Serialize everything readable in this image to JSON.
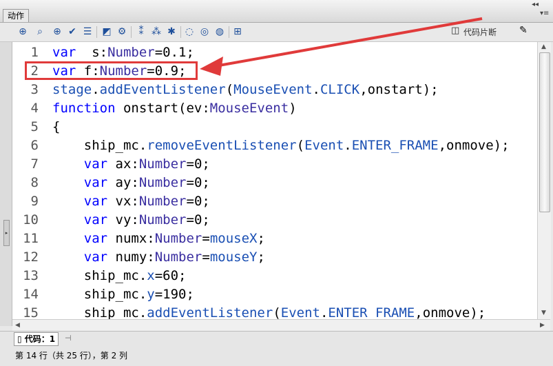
{
  "panel": {
    "tab_label": "动作",
    "collapse_glyph": "◂◂",
    "menu_glyph": "▾≡"
  },
  "toolbar": {
    "icons": [
      "add-statement-icon",
      "find-icon",
      "insert-target-path-icon",
      "check-syntax-icon",
      "auto-format-icon",
      "code-hint-icon",
      "debug-options-icon",
      "collapse-between-braces-icon",
      "collapse-selection-icon",
      "expand-all-icon",
      "apply-block-comment-icon",
      "apply-line-comment-icon",
      "remove-comment-icon",
      "show-hide-toolbox-icon"
    ],
    "snippets_label": "代码片断",
    "wand_icon": "magic-wand-icon"
  },
  "code_lines": [
    {
      "n": "1",
      "tokens": [
        [
          "kw",
          "var"
        ],
        [
          "",
          "  s:"
        ],
        [
          "ty",
          "Number"
        ],
        [
          "",
          "=0.1;"
        ]
      ]
    },
    {
      "n": "2",
      "tokens": [
        [
          "kw",
          "var"
        ],
        [
          "",
          " f:"
        ],
        [
          "ty",
          "Number"
        ],
        [
          "",
          "=0.9;"
        ]
      ]
    },
    {
      "n": "3",
      "tokens": [
        [
          "pm",
          "stage"
        ],
        [
          "",
          "."
        ],
        [
          "pm",
          "addEventListener"
        ],
        [
          "",
          "("
        ],
        [
          "pm",
          "MouseEvent"
        ],
        [
          "",
          "."
        ],
        [
          "pm",
          "CLICK"
        ],
        [
          "",
          ",onstart);"
        ]
      ]
    },
    {
      "n": "4",
      "tokens": [
        [
          "kw",
          "function"
        ],
        [
          "",
          " onstart(ev:"
        ],
        [
          "ty",
          "MouseEvent"
        ],
        [
          "",
          ")"
        ]
      ]
    },
    {
      "n": "5",
      "tokens": [
        [
          "",
          "{"
        ]
      ]
    },
    {
      "n": "6",
      "tokens": [
        [
          "",
          "    ship_mc."
        ],
        [
          "pm",
          "removeEventListener"
        ],
        [
          "",
          "("
        ],
        [
          "pm",
          "Event"
        ],
        [
          "",
          "."
        ],
        [
          "pm",
          "ENTER_FRAME"
        ],
        [
          "",
          ",onmove);"
        ]
      ]
    },
    {
      "n": "7",
      "tokens": [
        [
          "",
          "    "
        ],
        [
          "kw",
          "var"
        ],
        [
          "",
          " ax:"
        ],
        [
          "ty",
          "Number"
        ],
        [
          "",
          "=0;"
        ]
      ]
    },
    {
      "n": "8",
      "tokens": [
        [
          "",
          "    "
        ],
        [
          "kw",
          "var"
        ],
        [
          "",
          " ay:"
        ],
        [
          "ty",
          "Number"
        ],
        [
          "",
          "=0;"
        ]
      ]
    },
    {
      "n": "9",
      "tokens": [
        [
          "",
          "    "
        ],
        [
          "kw",
          "var"
        ],
        [
          "",
          " vx:"
        ],
        [
          "ty",
          "Number"
        ],
        [
          "",
          "=0;"
        ]
      ]
    },
    {
      "n": "10",
      "tokens": [
        [
          "",
          "    "
        ],
        [
          "kw",
          "var"
        ],
        [
          "",
          " vy:"
        ],
        [
          "ty",
          "Number"
        ],
        [
          "",
          "=0;"
        ]
      ]
    },
    {
      "n": "11",
      "tokens": [
        [
          "",
          "    "
        ],
        [
          "kw",
          "var"
        ],
        [
          "",
          " numx:"
        ],
        [
          "ty",
          "Number"
        ],
        [
          "",
          "="
        ],
        [
          "pm",
          "mouseX"
        ],
        [
          "",
          ";"
        ]
      ]
    },
    {
      "n": "12",
      "tokens": [
        [
          "",
          "    "
        ],
        [
          "kw",
          "var"
        ],
        [
          "",
          " numy:"
        ],
        [
          "ty",
          "Number"
        ],
        [
          "",
          "="
        ],
        [
          "pm",
          "mouseY"
        ],
        [
          "",
          ";"
        ]
      ]
    },
    {
      "n": "13",
      "tokens": [
        [
          "",
          "    ship_mc."
        ],
        [
          "pm",
          "x"
        ],
        [
          "",
          "=60;"
        ]
      ]
    },
    {
      "n": "14",
      "tokens": [
        [
          "",
          "    ship_mc."
        ],
        [
          "pm",
          "y"
        ],
        [
          "",
          "=190;"
        ]
      ]
    },
    {
      "n": "15",
      "tokens": [
        [
          "",
          "    ship_mc."
        ],
        [
          "pm",
          "addEventListener"
        ],
        [
          "",
          "("
        ],
        [
          "pm",
          "Event"
        ],
        [
          "",
          "."
        ],
        [
          "pm",
          "ENTER_FRAME"
        ],
        [
          "",
          ",onmove);"
        ]
      ]
    }
  ],
  "bottom": {
    "code_tab_label": "代码：1",
    "status_text": "第 14 行（共 25 行），第 2 列"
  },
  "annotation": {
    "highlight_color": "#e03a3a",
    "highlighted_line": "2"
  }
}
